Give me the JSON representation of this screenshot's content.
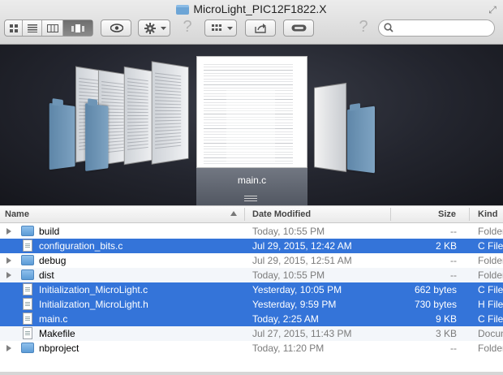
{
  "window": {
    "title": "MicroLight_PIC12F1822.X"
  },
  "toolbar": {
    "view_buttons": [
      "icon-view",
      "list-view",
      "column-view",
      "coverflow-view"
    ],
    "help_glyph": "?",
    "search": {
      "value": "",
      "placeholder": ""
    }
  },
  "coverflow": {
    "selected_label": "main.c"
  },
  "columns": {
    "name": "Name",
    "date": "Date Modified",
    "size": "Size",
    "kind": "Kind"
  },
  "files": [
    {
      "name": "build",
      "date": "Today, 10:55 PM",
      "size": "--",
      "kind": "Folder",
      "type": "folder",
      "selected": false
    },
    {
      "name": "configuration_bits.c",
      "date": "Jul 29, 2015, 12:42 AM",
      "size": "2 KB",
      "kind": "C File",
      "type": "file",
      "selected": true
    },
    {
      "name": "debug",
      "date": "Jul 29, 2015, 12:51 AM",
      "size": "--",
      "kind": "Folder",
      "type": "folder",
      "selected": false
    },
    {
      "name": "dist",
      "date": "Today, 10:55 PM",
      "size": "--",
      "kind": "Folder",
      "type": "folder",
      "selected": false
    },
    {
      "name": "Initialization_MicroLight.c",
      "date": "Yesterday, 10:05 PM",
      "size": "662 bytes",
      "kind": "C File",
      "type": "file",
      "selected": true
    },
    {
      "name": "Initialization_MicroLight.h",
      "date": "Yesterday, 9:59 PM",
      "size": "730 bytes",
      "kind": "H File",
      "type": "file",
      "selected": true
    },
    {
      "name": "main.c",
      "date": "Today, 2:25 AM",
      "size": "9 KB",
      "kind": "C File",
      "type": "file",
      "selected": true
    },
    {
      "name": "Makefile",
      "date": "Jul 27, 2015, 11:43 PM",
      "size": "3 KB",
      "kind": "Document",
      "type": "file",
      "selected": false
    },
    {
      "name": "nbproject",
      "date": "Today, 11:20 PM",
      "size": "--",
      "kind": "Folder",
      "type": "folder",
      "selected": false
    }
  ],
  "colors": {
    "selection": "#3474d9",
    "toolbar_bg": "#dcdcdc",
    "coverflow_bg": "#23252e"
  }
}
